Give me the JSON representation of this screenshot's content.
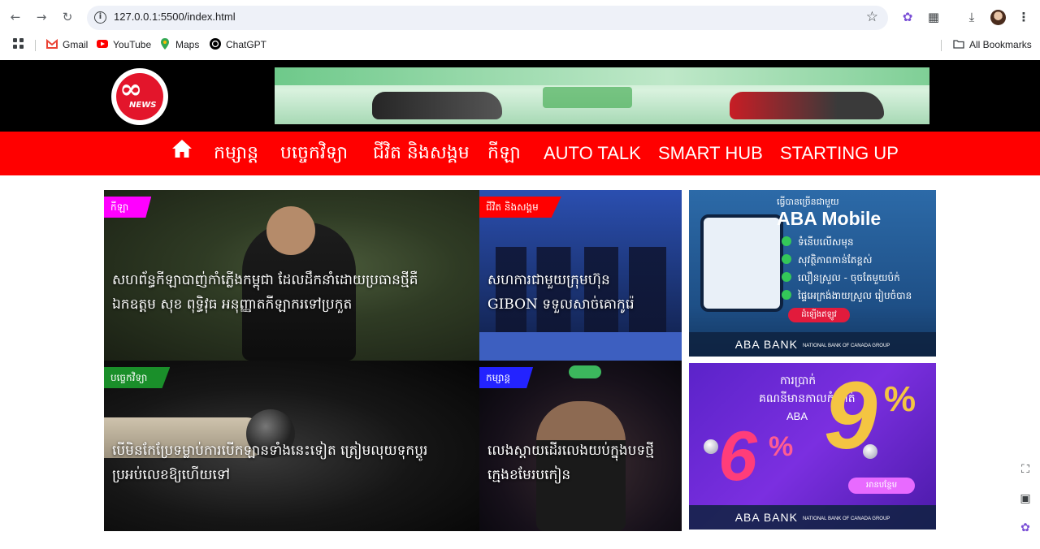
{
  "browser": {
    "url": "127.0.0.1:5500/index.html",
    "bookmarks": [
      {
        "label": "Gmail",
        "icon": "gmail-icon"
      },
      {
        "label": "YouTube",
        "icon": "youtube-icon"
      },
      {
        "label": "Maps",
        "icon": "maps-icon"
      },
      {
        "label": "ChatGPT",
        "icon": "chatgpt-icon"
      }
    ],
    "all_bookmarks": "All Bookmarks"
  },
  "site": {
    "logo_text": "NEWS",
    "nav": [
      {
        "label": "កម្សាន្ត"
      },
      {
        "label": "បច្ចេកវិទ្យា"
      },
      {
        "label": "ជីវិត និងសង្គម"
      },
      {
        "label": "កីឡា"
      },
      {
        "label": "AUTO TALK"
      },
      {
        "label": "SMART HUB"
      },
      {
        "label": "STARTING UP"
      }
    ]
  },
  "articles": [
    {
      "tag": "កីឡា",
      "headline_line1": "សហព័ន្ធកីឡាបាញ់កាំភ្លើងកម្ពុជា ដែលដឹកនាំដោយប្រធានថ្មីគឺ",
      "headline_line2": "ឯកឧត្តម សុខ ពុទ្ធិវុធ អនុញ្ញាតកីឡាករទៅប្រកួត",
      "tag_color": "#ff00ff"
    },
    {
      "tag": "ជីវិត និងសង្គម",
      "headline_line1": "សហការជាមួយក្រុមហ៊ុន",
      "headline_line2": "GIBON ទទួលសាច់គោកូរ៉េ",
      "tag_color": "#ff0000"
    },
    {
      "tag": "បច្ចេកវិទ្យា",
      "headline_line1": "បើមិនកែប្រែទម្លាប់ការបើកឡានទាំងនេះទៀត ត្រៀមលុយទុកប្ដូរ",
      "headline_line2": "ប្រអប់លេខឱ្យហើយទៅ",
      "tag_color": "#1a8f2a"
    },
    {
      "tag": "កម្សាន្ត",
      "headline_line1": "លេងស្ដាយដើរលេងយប់ក្នុងបទថ្មី",
      "headline_line2": "ក្មេងខមែរបកៀន",
      "tag_color": "#2323ff"
    }
  ],
  "ads": {
    "aba_mobile": {
      "kicker": "ធ្វើបានច្រើនជាមួយ",
      "title": "ABA Mobile",
      "features": [
        "ទំនើបលើសមុន",
        "សុវត្ថិភាពកាន់តែខ្ពស់",
        "លឿនស្រួល - ចុចតែមួយប៉ក់",
        "ផ្ទៃអេក្រង់ងាយស្រួល រៀបចំបាន"
      ],
      "cta": "ដំឡើងឥឡូវ",
      "footer": "ABA BANK",
      "footer_sub": "NATIONAL BANK OF CANADA GROUP"
    },
    "aba_deposit": {
      "kicker": "ការប្រាក់",
      "kicker2": "គណនីមានកាលកំណត់",
      "abax": "ABA",
      "rate_low": "6",
      "rate_high": "9",
      "pct": "%",
      "cta": "អានបន្ថែម",
      "footer": "ABA BANK",
      "footer_sub": "NATIONAL BANK OF CANADA GROUP"
    }
  }
}
